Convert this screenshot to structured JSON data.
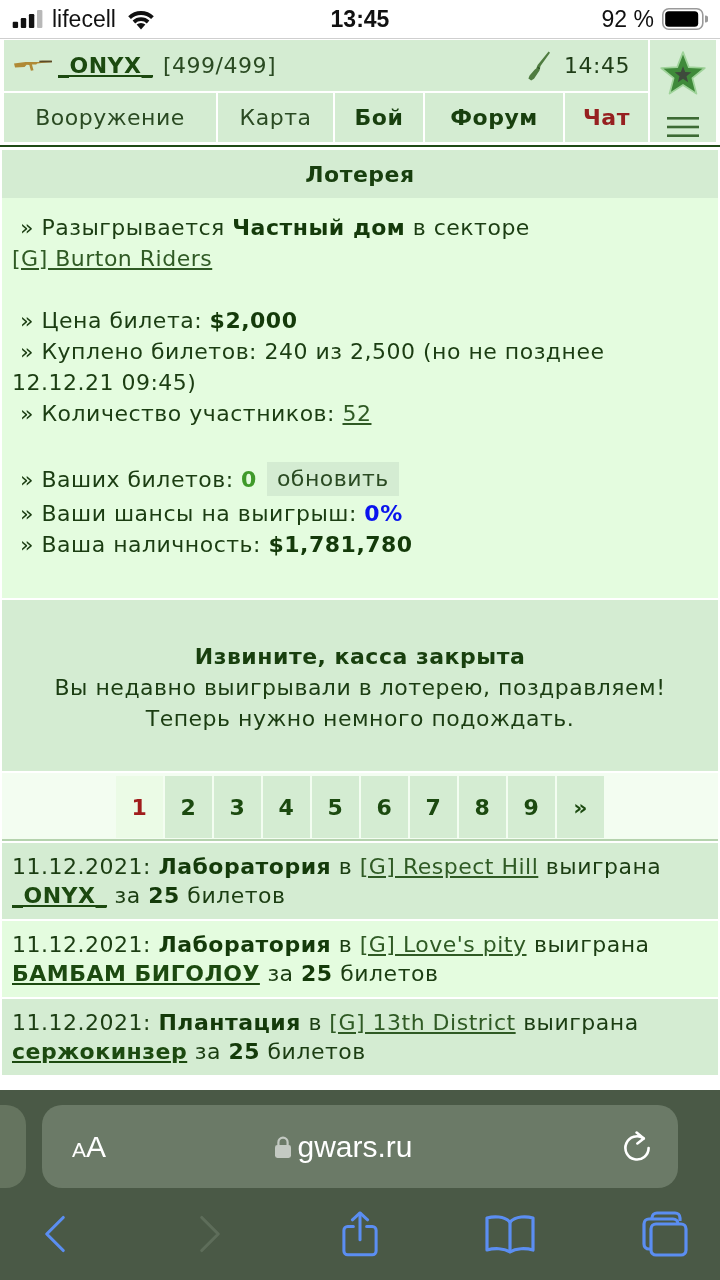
{
  "status_bar": {
    "carrier": "lifecell",
    "time": "13:45",
    "battery": "92 %"
  },
  "header": {
    "player": {
      "name": "_ONYX_",
      "hp": "[499/499]"
    },
    "server_time": "14:45"
  },
  "nav": {
    "tabs": [
      {
        "label": "Вооружение",
        "kind": "plain"
      },
      {
        "label": "Карта",
        "kind": "plain"
      },
      {
        "label": "Бой",
        "kind": "bold"
      },
      {
        "label": "Форум",
        "kind": "bold"
      },
      {
        "label": "Чат",
        "kind": "alert"
      }
    ]
  },
  "lottery": {
    "title": "Лотерея",
    "groups": [
      [
        {
          "text": "» Разыгрывается **Частный дом** в секторе",
          "link": "[G] Burton Riders"
        }
      ],
      [
        {
          "text": "» Цена билета: **$2,000**"
        },
        {
          "text": "» Куплено билетов: 240 из 2,500 (но не позднее 12.12.21 09:45)"
        },
        {
          "text": "» Количество участников:",
          "link": "52"
        }
      ],
      [
        {
          "text": "» Ваших билетов:",
          "value": "0",
          "color": "#3f9a2a",
          "button": "обновить"
        },
        {
          "text": "» Ваши шансы на выигрыш:",
          "value": "0%",
          "color": "#0a14ee"
        },
        {
          "text": "» Ваша наличность: **$1,781,780**"
        }
      ]
    ]
  },
  "notice": {
    "title": "Извините, касса закрыта",
    "lines": [
      "Вы недавно выигрывали в лотерею, поздравляем!",
      "Теперь нужно немного подождать."
    ]
  },
  "pagination": {
    "pages": [
      {
        "label": "1",
        "selected": true
      },
      {
        "label": "2",
        "selected": false
      },
      {
        "label": "3",
        "selected": false
      },
      {
        "label": "4",
        "selected": false
      },
      {
        "label": "5",
        "selected": false
      },
      {
        "label": "6",
        "selected": false
      },
      {
        "label": "7",
        "selected": false
      },
      {
        "label": "8",
        "selected": false
      },
      {
        "label": "9",
        "selected": false
      }
    ],
    "next": "»"
  },
  "winners": [
    {
      "text": "11.12.2021: **Лаборатория** в",
      "sector": "[G] Respect Hill",
      "verb": "выиграна",
      "winner": "_ONYX_",
      "tail": "за **25** билетов"
    },
    {
      "text": "11.12.2021: **Лаборатория** в",
      "sector": "[G] Love's pity",
      "verb": "выиграна",
      "winner": "БАМБАМ БИГОЛОУ",
      "tail": "за **25** билетов"
    },
    {
      "text": "11.12.2021: **Плантация** в",
      "sector": "[G] 13th District",
      "verb": "выиграна",
      "winner": "сержокинзер",
      "tail": "за **25** билетов"
    }
  ],
  "browser": {
    "text_size": "AA",
    "url": "gwars.ru",
    "toolbar": [
      {
        "kind": "back",
        "disabled": false
      },
      {
        "kind": "forward",
        "disabled": true
      },
      {
        "kind": "share",
        "disabled": false
      },
      {
        "kind": "bookmarks",
        "disabled": false
      },
      {
        "kind": "tabs",
        "disabled": false
      }
    ]
  }
}
